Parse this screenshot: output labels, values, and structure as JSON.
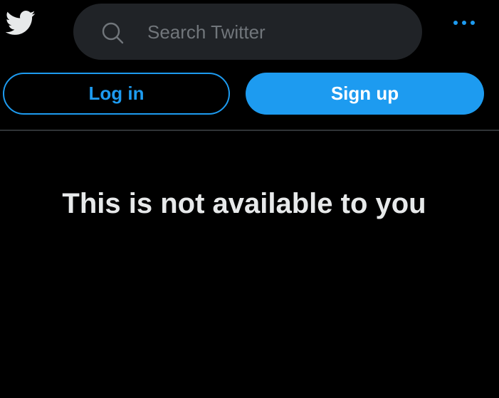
{
  "header": {
    "logo_icon": "twitter-bird-icon",
    "search": {
      "icon": "search-icon",
      "placeholder": "Search Twitter",
      "value": ""
    },
    "more_icon": "more-options-icon"
  },
  "auth": {
    "login_label": "Log in",
    "signup_label": "Sign up"
  },
  "main": {
    "message": "This is not available to you"
  },
  "colors": {
    "background": "#000000",
    "accent": "#1d9bf0",
    "search_bg": "#202327",
    "text_primary": "#e7e9ea",
    "text_secondary": "#71767b",
    "divider": "#2f3336"
  }
}
